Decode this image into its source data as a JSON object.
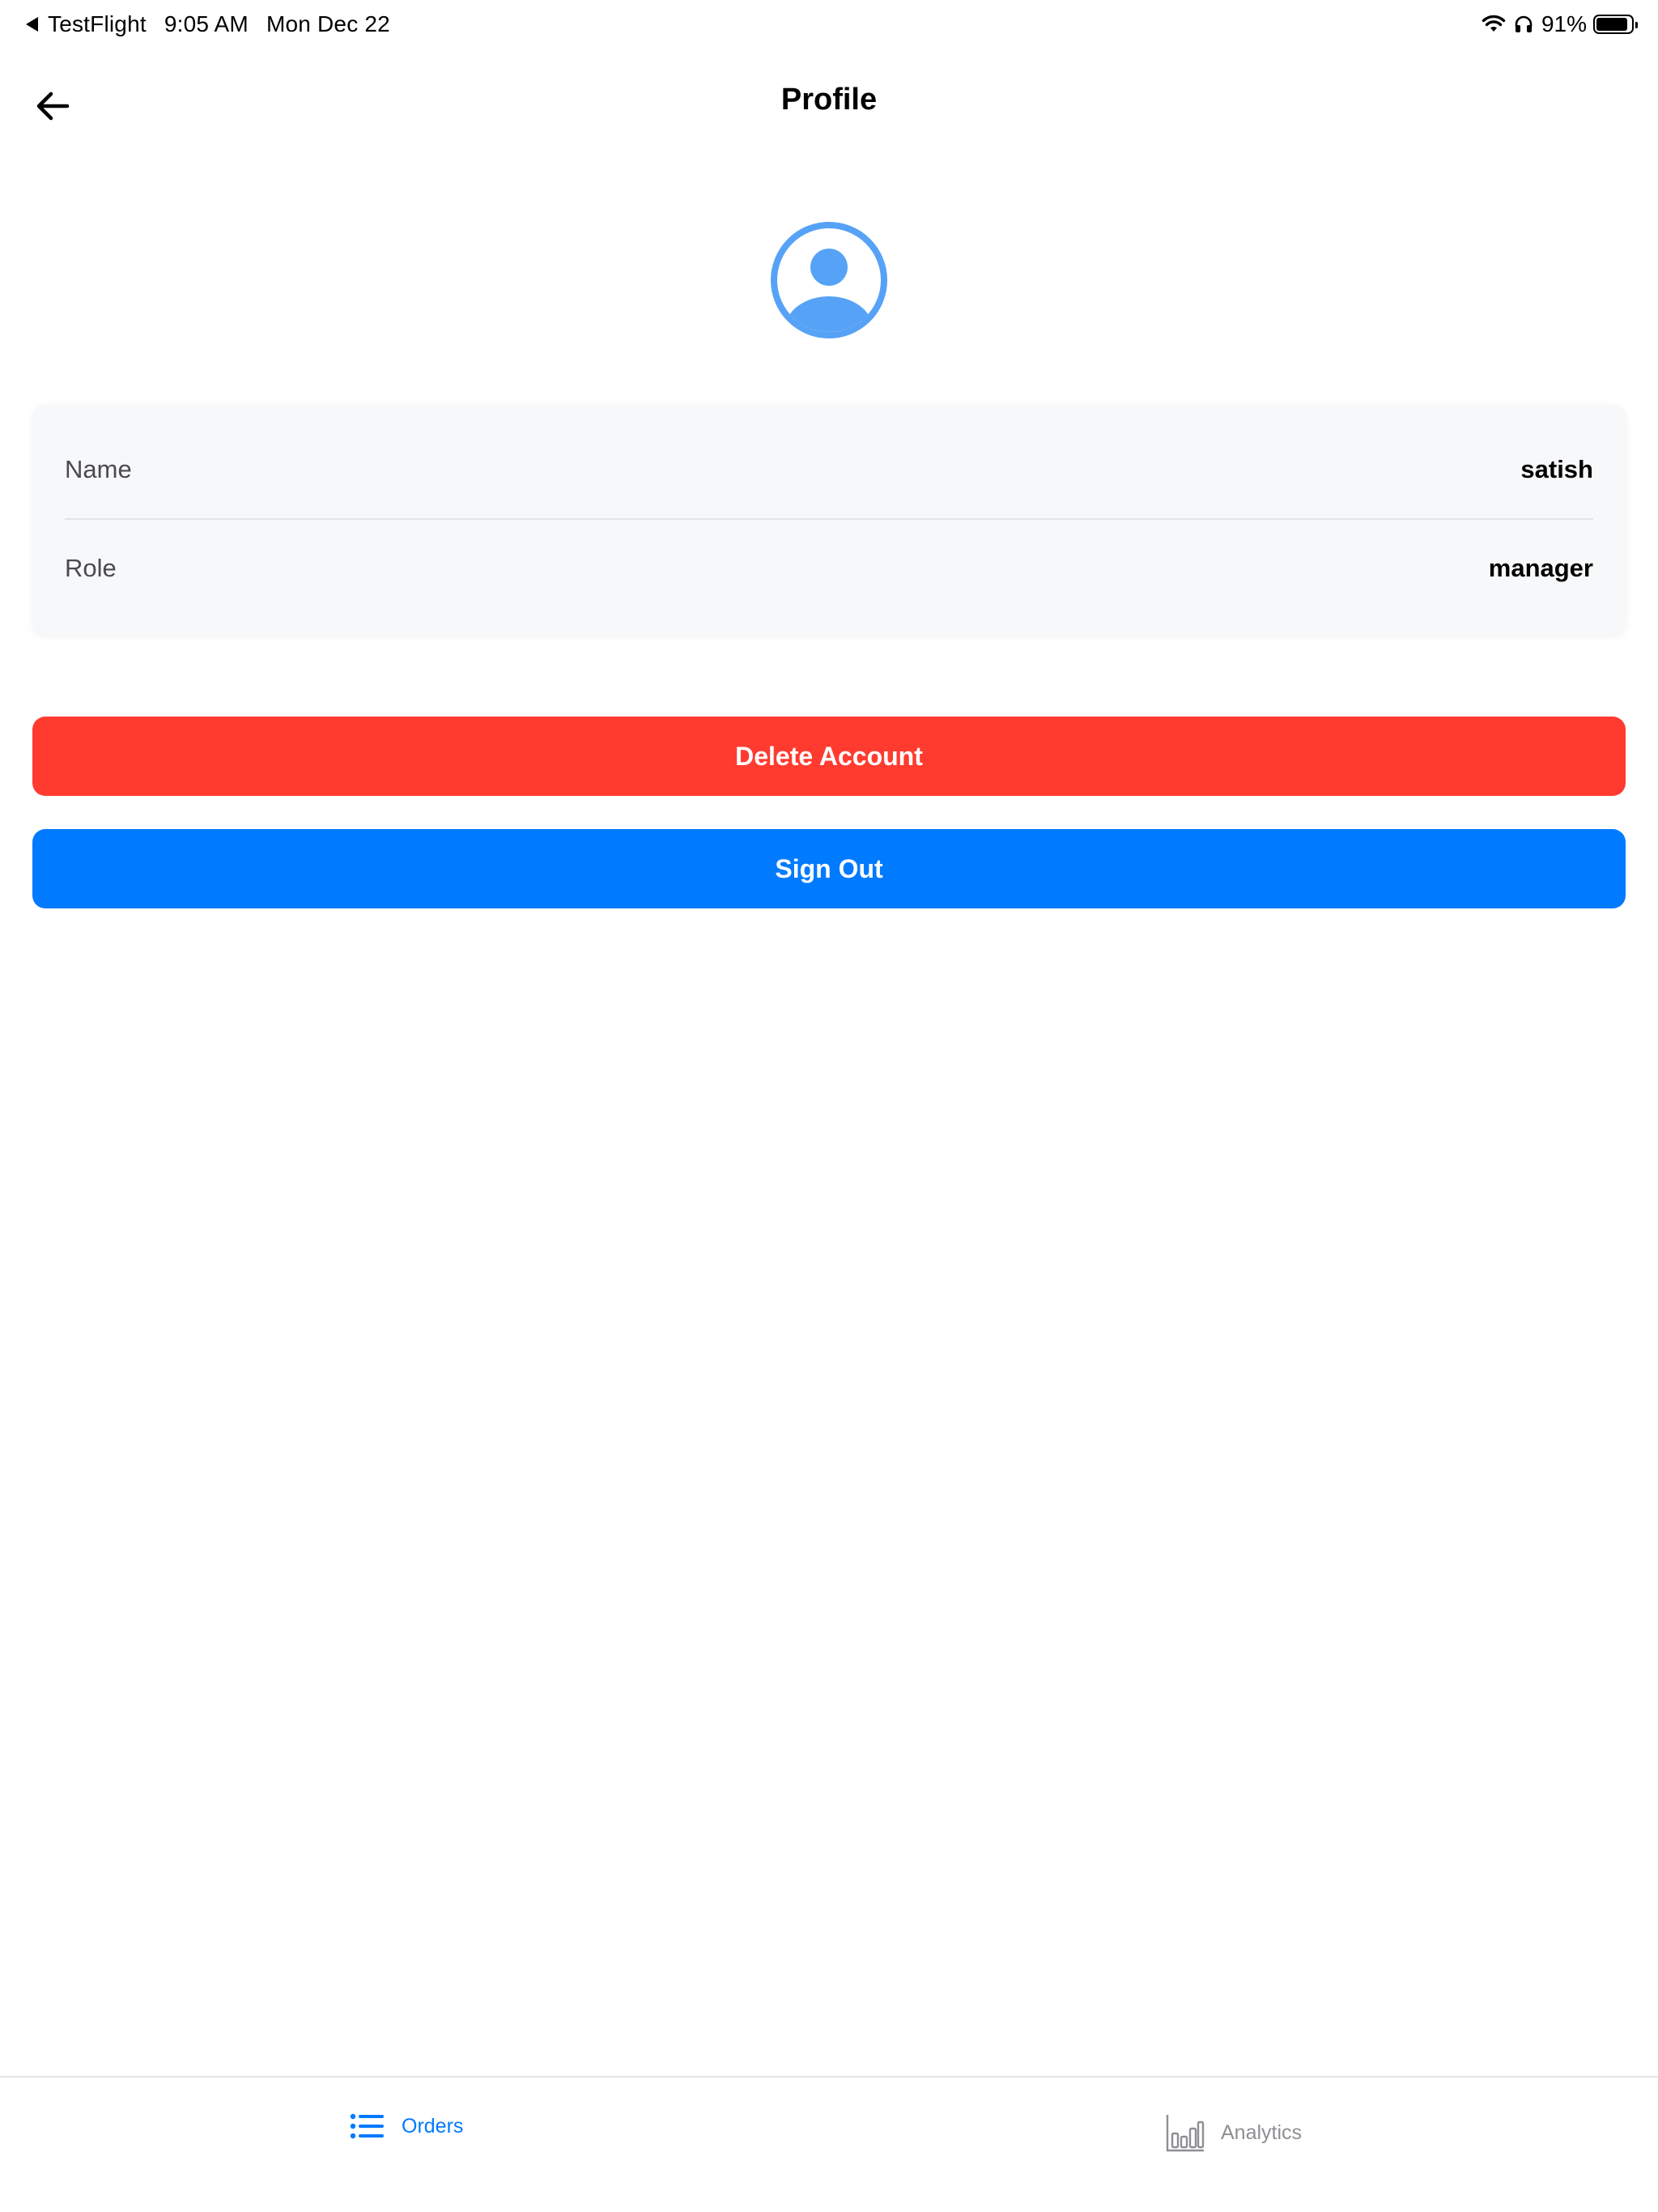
{
  "status_bar": {
    "back_app": "TestFlight",
    "time": "9:05 AM",
    "date": "Mon Dec 22",
    "battery_percent": "91%",
    "battery_level": 0.91
  },
  "header": {
    "title": "Profile"
  },
  "profile": {
    "rows": [
      {
        "label": "Name",
        "value": "satish"
      },
      {
        "label": "Role",
        "value": "manager"
      }
    ]
  },
  "actions": {
    "delete_label": "Delete Account",
    "signout_label": "Sign Out"
  },
  "tabs": [
    {
      "label": "Orders",
      "icon": "list-icon",
      "active": true
    },
    {
      "label": "Analytics",
      "icon": "bar-chart-icon",
      "active": false
    }
  ],
  "colors": {
    "accent": "#007aff",
    "danger": "#ff3b30",
    "avatar": "#56a2f7"
  }
}
